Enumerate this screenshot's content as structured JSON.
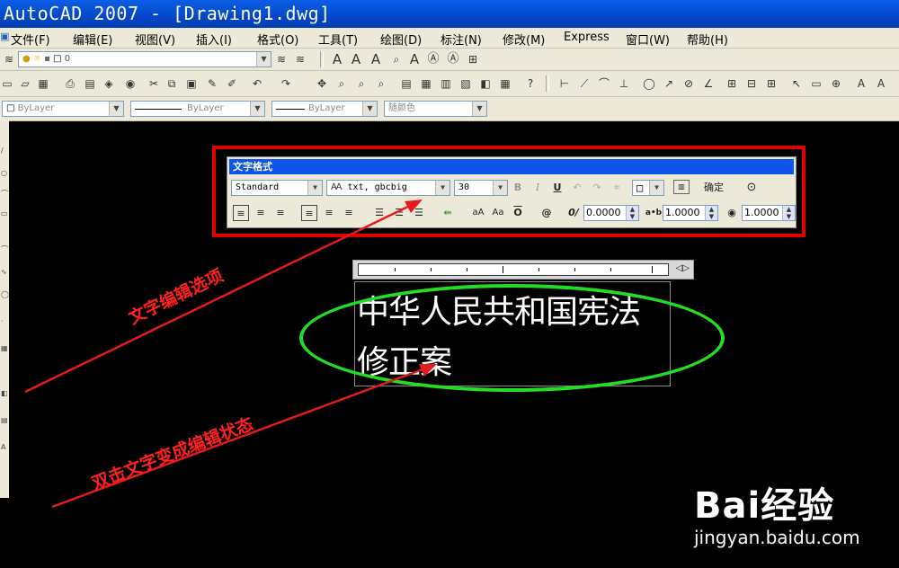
{
  "window": {
    "title": "AutoCAD 2007 - [Drawing1.dwg]"
  },
  "menu": [
    "文件(F)",
    "编辑(E)",
    "视图(V)",
    "插入(I)",
    "格式(O)",
    "工具(T)",
    "绘图(D)",
    "标注(N)",
    "修改(M)",
    "Express",
    "窗口(W)",
    "帮助(H)"
  ],
  "layer_toolbar": {
    "current_layer": "0"
  },
  "properties_toolbar": {
    "color": "ByLayer",
    "linetype": "ByLayer",
    "lineweight": "ByLayer",
    "plot_style": "随颜色"
  },
  "text_format": {
    "caption": "文字格式",
    "style": "Standard",
    "font": "txt, gbcbig",
    "height": "30",
    "ok_label": "确定",
    "oblique": "0.0000",
    "tracking": "1.0000",
    "width_factor": "1.0000"
  },
  "editor": {
    "text": "中华人民共和国宪法修正案"
  },
  "annotations": {
    "top": "文字编辑选项",
    "bottom": "双击文字变成编辑状态"
  },
  "watermark": {
    "brand": "Bai经验",
    "url": "jingyan.baidu.com"
  },
  "colors": {
    "highlight_box": "#e00000",
    "highlight_ellipse": "#22dd22",
    "arrow": "#ff2020"
  }
}
